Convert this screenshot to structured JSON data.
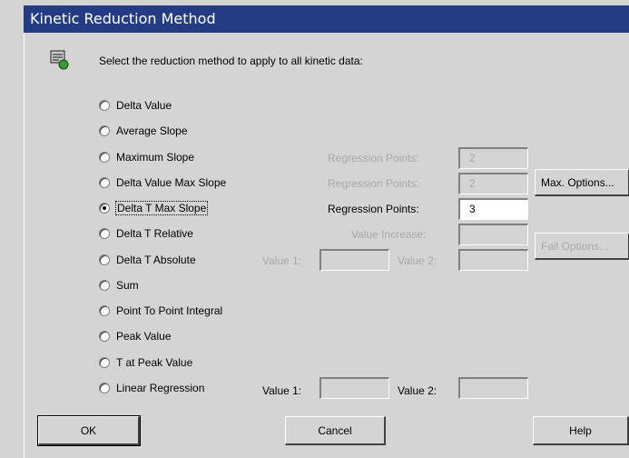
{
  "window": {
    "title": "Kinetic Reduction Method"
  },
  "instruction": "Select the reduction method to apply to all kinetic data:",
  "methods": [
    {
      "label": "Delta Value",
      "selected": false
    },
    {
      "label": "Average Slope",
      "selected": false
    },
    {
      "label": "Maximum  Slope",
      "selected": false
    },
    {
      "label": "Delta Value Max Slope",
      "selected": false
    },
    {
      "label": "Delta T Max Slope",
      "selected": true
    },
    {
      "label": "Delta T Relative",
      "selected": false
    },
    {
      "label": "Delta T Absolute",
      "selected": false
    },
    {
      "label": "Sum",
      "selected": false
    },
    {
      "label": "Point To Point Integral",
      "selected": false
    },
    {
      "label": "Peak Value",
      "selected": false
    },
    {
      "label": "T at Peak Value",
      "selected": false
    },
    {
      "label": "Linear Regression",
      "selected": false
    }
  ],
  "params": {
    "max_slope_regression": {
      "label": "Regression Points:",
      "value": "2",
      "enabled": false
    },
    "dv_max_slope_regression": {
      "label": "Regression Points:",
      "value": "2",
      "enabled": false
    },
    "dt_max_slope_regression": {
      "label": "Regression Points:",
      "value": "3",
      "enabled": true
    },
    "value_increase": {
      "label": "Value Increase:",
      "value": "",
      "enabled": false
    },
    "dt_absolute_value1": {
      "label": "Value 1:",
      "value": "",
      "enabled": false
    },
    "dt_absolute_value2": {
      "label": "Value 2:",
      "value": "",
      "enabled": false
    },
    "linreg_value1": {
      "label": "Value 1:",
      "value": "",
      "enabled": true
    },
    "linreg_value2": {
      "label": "Value 2:",
      "value": "",
      "enabled": true
    }
  },
  "buttons": {
    "max_options": "Max. Options...",
    "fail_options": "Fail Options...",
    "ok": "OK",
    "cancel": "Cancel",
    "help": "Help"
  }
}
